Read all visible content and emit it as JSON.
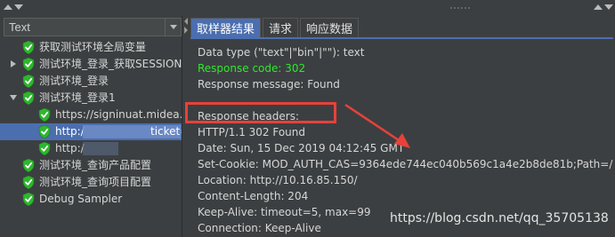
{
  "window": {
    "collapse_icon": "arrow-up-icon",
    "expand_icon": "arrow-down-icon"
  },
  "left": {
    "combo_value": "Text",
    "tree": [
      {
        "label": "获取测试环境全局变量",
        "status": "success",
        "expandable": false
      },
      {
        "label": "测试环境_登录_获取SESSION",
        "status": "success",
        "expandable": true,
        "expanded": false
      },
      {
        "label": "测试环境_登录",
        "status": "success",
        "expandable": false
      },
      {
        "label": "测试环境_登录1",
        "status": "success",
        "expandable": true,
        "expanded": true
      },
      {
        "label": "https://signinuat.midea.com",
        "status": "success",
        "expandable": false
      },
      {
        "label": "http:/",
        "label_tail": "ticket=S",
        "status": "success",
        "expandable": false,
        "selected": true
      },
      {
        "label": "http:/",
        "status": "success",
        "expandable": false
      },
      {
        "label": "测试环境_查询产品配置",
        "status": "success",
        "expandable": false
      },
      {
        "label": "测试环境_查询项目配置",
        "status": "success",
        "expandable": false
      },
      {
        "label": "Debug Sampler",
        "status": "success",
        "expandable": false
      }
    ]
  },
  "right": {
    "tabs": [
      {
        "label": "取样器结果",
        "active": true
      },
      {
        "label": "请求",
        "active": false
      },
      {
        "label": "响应数据",
        "active": false
      }
    ],
    "lines": [
      {
        "text": "Data type (\"text\"|\"bin\"|\"\"): text",
        "color": "default"
      },
      {
        "text": "Response code: 302",
        "color": "green"
      },
      {
        "text": "Response message: Found",
        "color": "default"
      },
      {
        "text": "",
        "color": "default"
      },
      {
        "text": "Response headers:",
        "color": "default"
      },
      {
        "text": "HTTP/1.1 302 Found",
        "color": "default"
      },
      {
        "text": "Date: Sun, 15 Dec 2019 04:12:45 GMT",
        "color": "default"
      },
      {
        "text": "Set-Cookie: MOD_AUTH_CAS=9364ede744ec040b569c1a4e2b8de81b;Path=/",
        "color": "default"
      },
      {
        "text": "Location: http://10.16.85.150/",
        "color": "default"
      },
      {
        "text": "Content-Length: 204",
        "color": "default"
      },
      {
        "text": "Keep-Alive: timeout=5, max=99",
        "color": "default"
      },
      {
        "text": "Connection: Keep-Alive",
        "color": "default"
      }
    ]
  },
  "annotation": {
    "highlight_color": "#e8413b"
  },
  "watermark": "https://blog.csdn.net/qq_35705138",
  "colors": {
    "background": "#3c3f41",
    "selection": "#4b6eaf",
    "success_green": "#2ee82e",
    "text": "#d6d6d6"
  }
}
